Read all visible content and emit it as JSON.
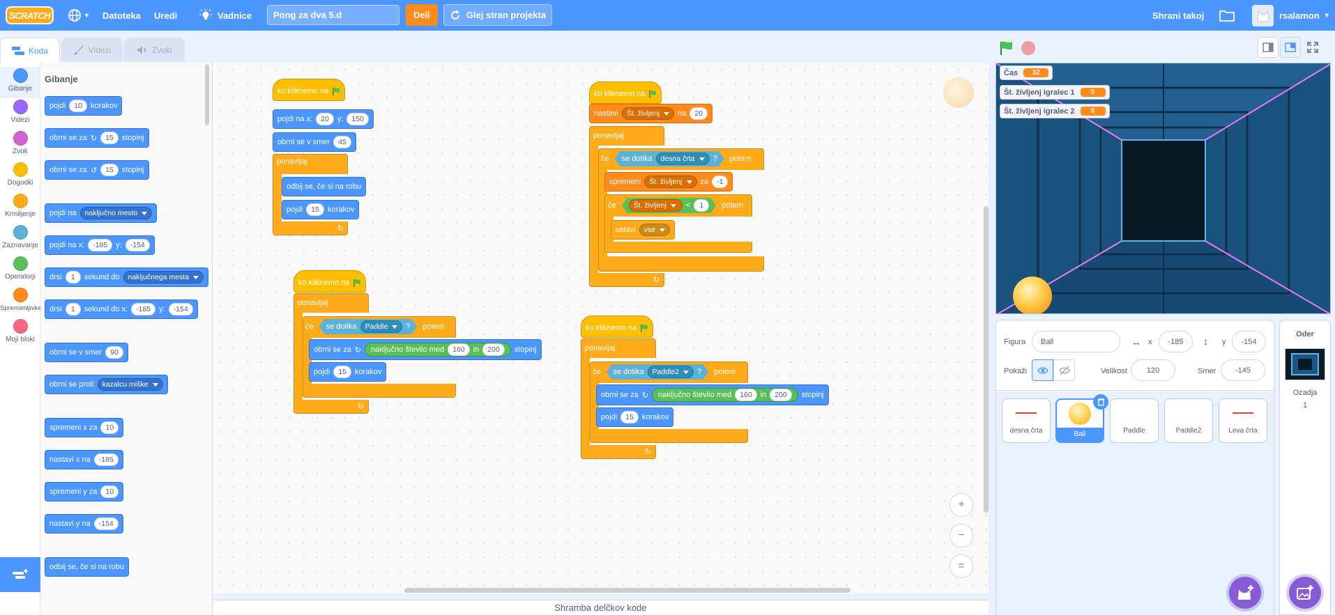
{
  "menubar": {
    "logo": "SCRATCH",
    "file": "Datoteka",
    "edit": "Uredi",
    "tutorials": "Vadnice",
    "project_title": "Pong za dva 5.d",
    "share": "Deli",
    "see_project": "Glej stran projekta",
    "save_copy": "Shrani takoj",
    "username": "rsalamon"
  },
  "tabs": {
    "code": "Koda",
    "costumes": "Videzi",
    "sounds": "Zvoki"
  },
  "categories": [
    {
      "label": "Gibanje",
      "color": "#4c97ff"
    },
    {
      "label": "Videzi",
      "color": "#9966ff"
    },
    {
      "label": "Zvok",
      "color": "#cf63cf"
    },
    {
      "label": "Dogodki",
      "color": "#ffbf00"
    },
    {
      "label": "Krmiljenje",
      "color": "#ffab19"
    },
    {
      "label": "Zaznavanje",
      "color": "#5cb1d6"
    },
    {
      "label": "Operatorji",
      "color": "#59c059"
    },
    {
      "label": "Spremenljivke",
      "color": "#ff8c1a"
    },
    {
      "label": "Moji bloki",
      "color": "#ff6680"
    }
  ],
  "palette": {
    "heading": "Gibanje",
    "move": "pojdi",
    "move_steps": "10",
    "steps": "korakov",
    "turn_right": "obrni se za",
    "turn_right_deg": "15",
    "degrees": "stopinj",
    "turn_left": "obrni se za",
    "turn_left_deg": "15",
    "goto": "pojdi na",
    "goto_target": "naključno mesto",
    "goto_xy": "pojdi na x:",
    "goto_x": "-185",
    "y_label": "y:",
    "goto_y": "-154",
    "glide": "drsi",
    "glide_secs": "1",
    "glide_to": "sekund do",
    "glide_target": "naključnega mesta",
    "glide_xy": "drsi",
    "glide_xy_secs": "1",
    "glide_xy_to": "sekund do x:",
    "glide_x": "-185",
    "glide_y": "-154",
    "point_dir": "obrni se v smer",
    "point_dir_val": "90",
    "point_towards": "obrni se proti",
    "point_target": "kazalcu miške",
    "change_x": "spremeni x za",
    "change_x_val": "10",
    "set_x": "nastavi x na",
    "set_x_val": "-185",
    "change_y": "spremeni y za",
    "change_y_val": "10",
    "set_y": "nastavi y na",
    "set_y_val": "-154",
    "bounce": "odbij se, če si na robu"
  },
  "scripts": {
    "s1": {
      "hat": "ko kliknemo na",
      "goto_xy": "pojdi na x:",
      "x": "20",
      "y_label": "y:",
      "y": "150",
      "point_dir": "obrni se v smer",
      "dir": "45",
      "forever": "ponavljaj",
      "bounce": "odbij se, če si na robu",
      "move": "pojdi",
      "steps_val": "15",
      "steps": "korakov"
    },
    "s2": {
      "hat": "ko kliknemo na",
      "forever": "ponavljaj",
      "if": "če",
      "touching": "se dotika",
      "target": "Paddle",
      "q": "?",
      "then": "potem",
      "turn": "obrni se za",
      "random": "naključno število med",
      "from": "160",
      "and": "in",
      "to": "200",
      "degrees": "stopinj",
      "move": "pojdi",
      "steps_val": "15",
      "steps": "korakov"
    },
    "s3": {
      "hat": "ko kliknemo na",
      "set": "nastavi",
      "var": "Št. življenj",
      "to_label": "na",
      "to_val": "20",
      "forever": "ponavljaj",
      "if": "če",
      "touching": "se dotika",
      "target": "desna črta",
      "q": "?",
      "then": "potem",
      "change": "spremeni",
      "change_var": "Št. življenj",
      "by": "za",
      "by_val": "-1",
      "if2": "če",
      "cmp_var": "Št. življenj",
      "lt": "<",
      "cmp_val": "1",
      "then2": "potem",
      "stop": "ustavi",
      "stop_opt": "vse"
    },
    "s4": {
      "hat": "ko kliknemo na",
      "forever": "ponavljaj",
      "if": "če",
      "touching": "se dotika",
      "target": "Paddle2",
      "q": "?",
      "then": "potem",
      "turn": "obrni se za",
      "random": "naključno število med",
      "from": "160",
      "and": "in",
      "to": "200",
      "degrees": "stopinj",
      "move": "pojdi",
      "steps_val": "15",
      "steps": "korakov"
    }
  },
  "zoom": {
    "in": "+",
    "out": "−",
    "reset": "="
  },
  "backpack": "Shramba delčkov kode",
  "stage": {
    "monitors": [
      {
        "label": "Čas",
        "value": "32"
      },
      {
        "label": "Št. življenj igralec 1",
        "value": "0"
      },
      {
        "label": "Št. življenj igralec 2",
        "value": "0"
      }
    ]
  },
  "sprite_info": {
    "sprite_label": "Figura",
    "sprite_name": "Ball",
    "x_label": "x",
    "x_val": "-185",
    "y_label": "y",
    "y_val": "-154",
    "show_label": "Pokaži",
    "size_label": "Velikost",
    "size_val": "120",
    "dir_label": "Smer",
    "dir_val": "-145"
  },
  "sprites": [
    "desna črta",
    "Ball",
    "Paddle",
    "Paddle2",
    "Leva črta"
  ],
  "backdrop": {
    "title": "Oder",
    "label": "Ozadja",
    "count": "1"
  },
  "colors": {
    "motion": "#4c97ff",
    "events": "#ffbf00",
    "control": "#ffab19",
    "variables": "#ff8c1a",
    "sensing": "#5cb1d6",
    "operators": "#59c059",
    "accent": "#4c97ff"
  }
}
